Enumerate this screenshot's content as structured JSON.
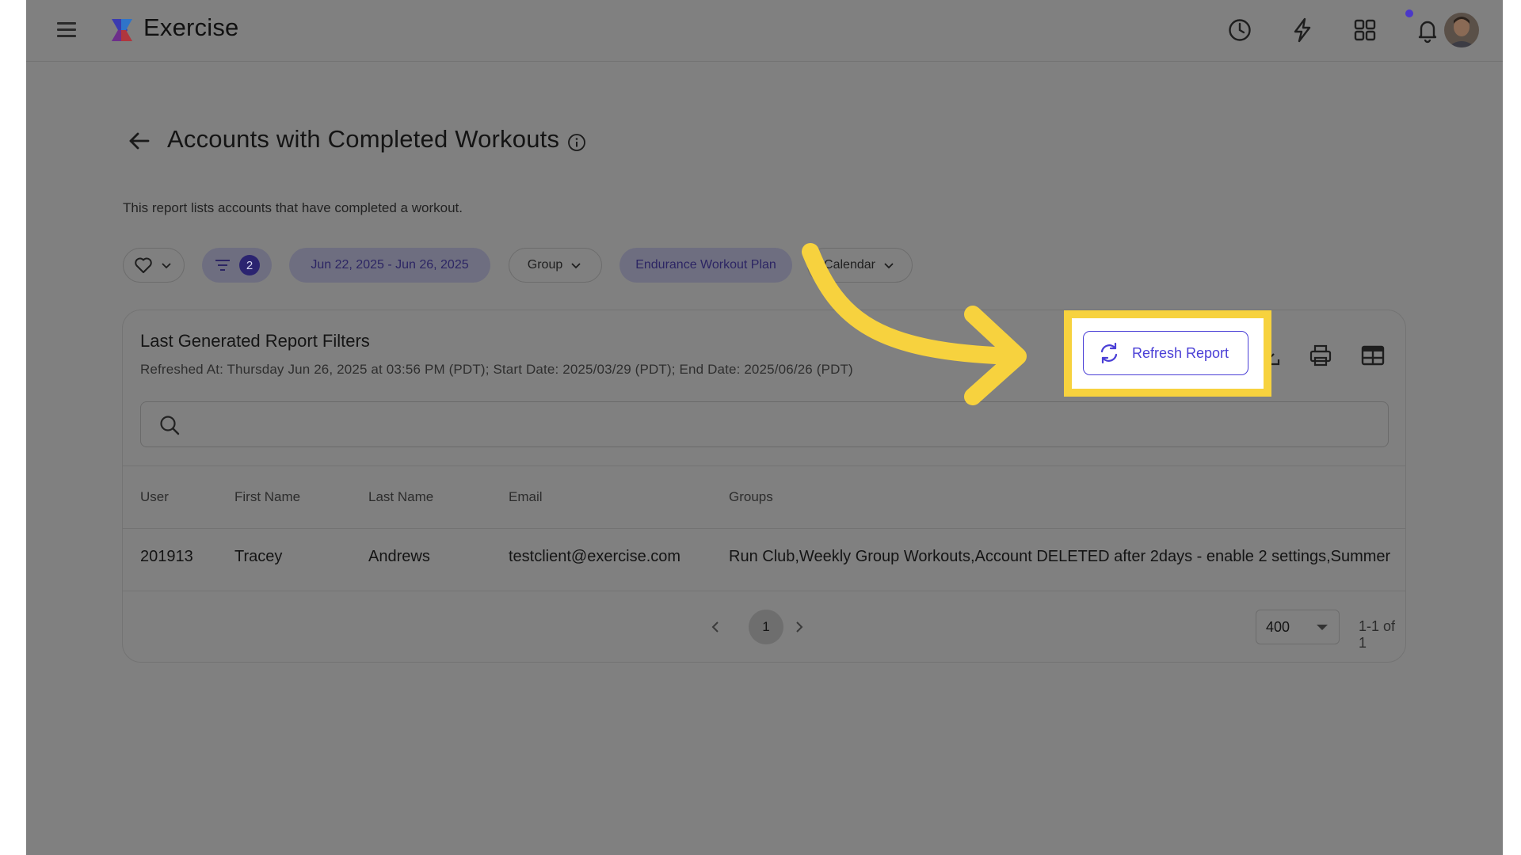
{
  "app": {
    "brand": "Exercise"
  },
  "header": {
    "icons": [
      "history-icon",
      "bolt-icon",
      "apps-grid-icon",
      "bell-icon"
    ],
    "has_notification": true,
    "avatar": "user-avatar"
  },
  "page": {
    "title": "Accounts with Completed Workouts",
    "description": "This report lists accounts that have completed a workout."
  },
  "filters": {
    "filter_count": "2",
    "date_range": "Jun 22, 2025 - Jun 26, 2025",
    "group_label": "Group",
    "workout_plan": "Endurance Workout Plan",
    "calendar_label": "Calendar"
  },
  "card": {
    "title": "Last Generated Report Filters",
    "subtitle": "Refreshed At: Thursday Jun 26, 2025 at 03:56 PM (PDT); Start Date: 2025/03/29 (PDT); End Date: 2025/06/26 (PDT)",
    "refresh_label": "Refresh Report",
    "search_placeholder": ""
  },
  "table": {
    "columns": [
      "User",
      "First Name",
      "Last Name",
      "Email",
      "Groups"
    ],
    "rows": [
      [
        "201913",
        "Tracey",
        "Andrews",
        "testclient@exercise.com",
        "Run Club,Weekly Group Workouts,Account DELETED after 2days - enable 2 settings,Summer"
      ]
    ]
  },
  "pagination": {
    "current_page": "1",
    "page_size": "400",
    "range": "1-1 of 1"
  },
  "colors": {
    "accent": "#4a3fd6",
    "highlight": "#f7d23e",
    "overlay": "#808080"
  }
}
